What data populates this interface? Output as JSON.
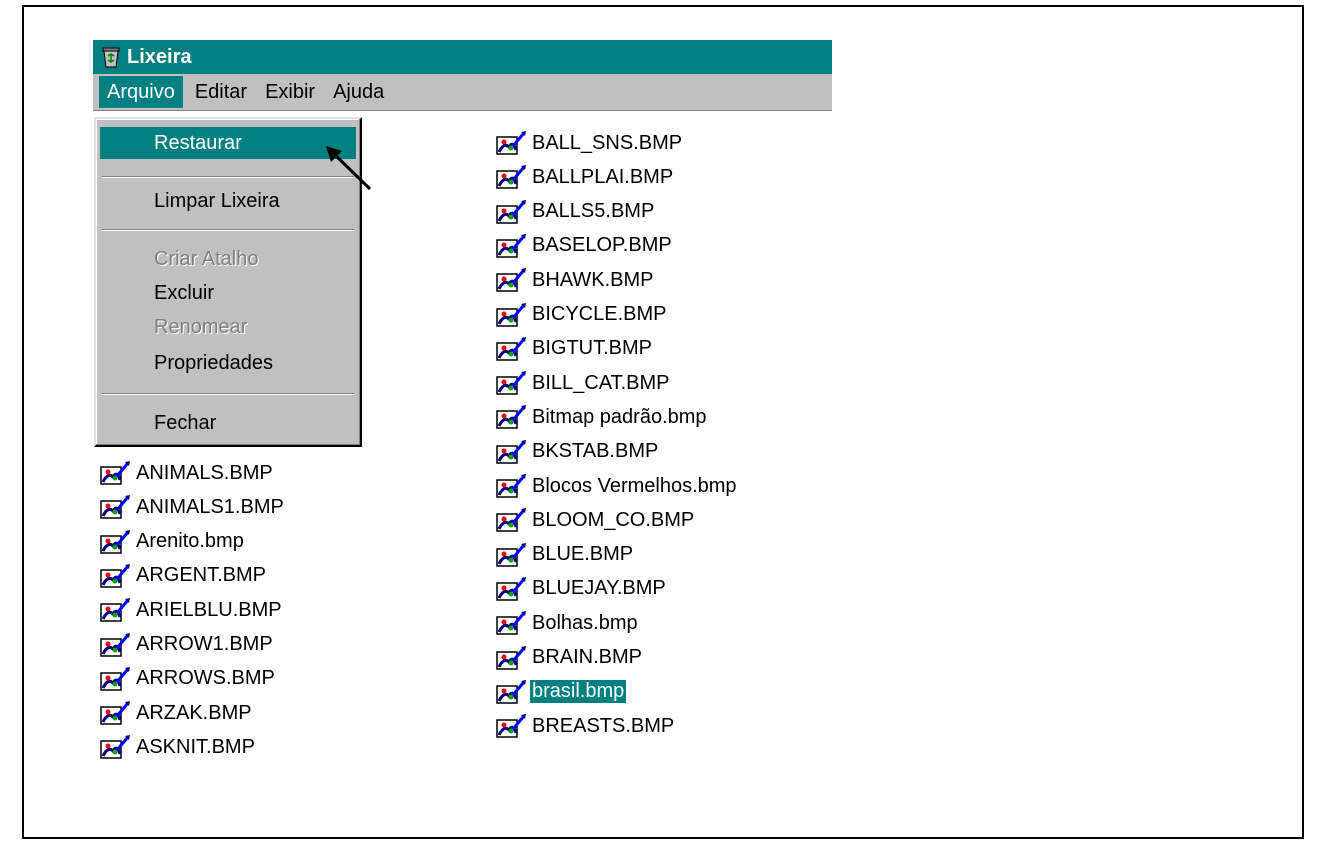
{
  "window": {
    "title": "Lixeira",
    "icon": "recycle-bin-icon"
  },
  "menubar": {
    "items": [
      "Arquivo",
      "Editar",
      "Exibir",
      "Ajuda"
    ],
    "active": "Arquivo"
  },
  "menu": {
    "items": [
      {
        "label": "Restaurar",
        "state": "highlighted"
      },
      {
        "label": "Limpar Lixeira",
        "state": "enabled"
      },
      {
        "label": "Criar Atalho",
        "state": "disabled"
      },
      {
        "label": "Excluir",
        "state": "enabled"
      },
      {
        "label": "Renomear",
        "state": "disabled"
      },
      {
        "label": "Propriedades",
        "state": "enabled"
      },
      {
        "label": "Fechar",
        "state": "enabled"
      }
    ]
  },
  "files": {
    "column1": [
      "ANIMALS.BMP",
      "ANIMALS1.BMP",
      "Arenito.bmp",
      "ARGENT.BMP",
      "ARIELBLU.BMP",
      "ARROW1.BMP",
      "ARROWS.BMP",
      "ARZAK.BMP",
      "ASKNIT.BMP"
    ],
    "column2": [
      "BALL_SNS.BMP",
      "BALLPLAI.BMP",
      "BALLS5.BMP",
      "BASELOP.BMP",
      "BHAWK.BMP",
      "BICYCLE.BMP",
      "BIGTUT.BMP",
      "BILL_CAT.BMP",
      "Bitmap padrão.bmp",
      "BKSTAB.BMP",
      "Blocos Vermelhos.bmp",
      "BLOOM_CO.BMP",
      "BLUE.BMP",
      "BLUEJAY.BMP",
      "Bolhas.bmp",
      "BRAIN.BMP",
      "brasil.bmp",
      "BREASTS.BMP"
    ],
    "selected": "brasil.bmp",
    "file_icon": "bitmap-file-icon"
  },
  "colors": {
    "title_bar": "#008080",
    "menu_bg": "#c0c0c0",
    "highlight": "#008080"
  }
}
